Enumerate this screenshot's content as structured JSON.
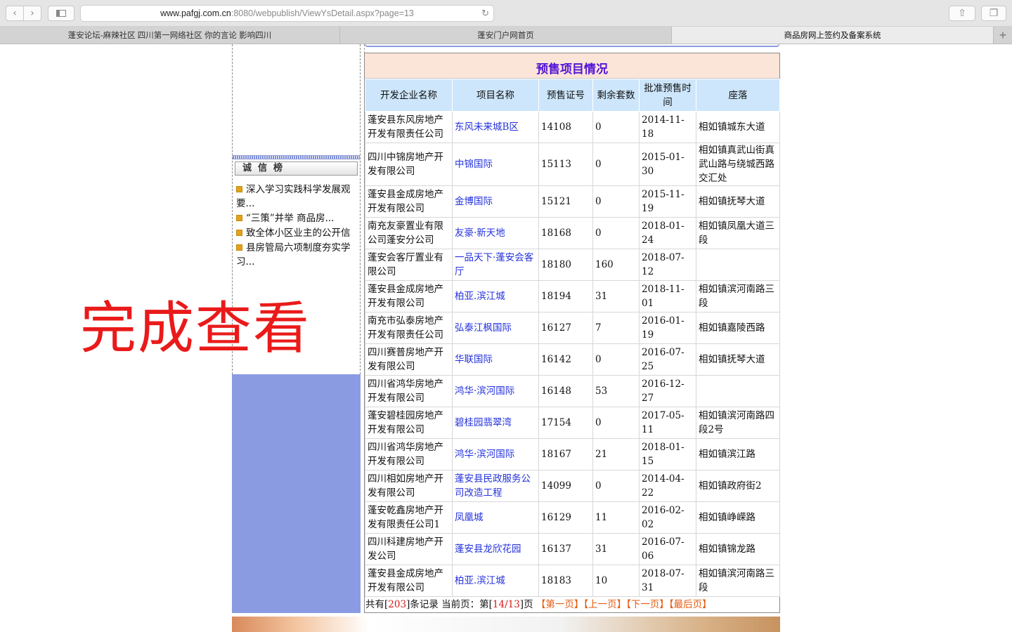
{
  "browser": {
    "url_host": "www.pafgj.com.cn",
    "url_rest": ":8080/webpublish/ViewYsDetail.aspx?page=13",
    "tabs": [
      {
        "label": "蓬安论坛-麻辣社区 四川第一网络社区 你的言论 影响四川"
      },
      {
        "label": "蓬安门户网首页"
      },
      {
        "label": "商品房网上签约及备案系统"
      }
    ]
  },
  "sidebar": {
    "section_title": "诚信榜",
    "items": [
      {
        "label": "深入学习实践科学发展观要..."
      },
      {
        "label": "“三策”并举 商品房..."
      },
      {
        "label": "致全体小区业主的公开信"
      },
      {
        "label": "县房管局六项制度夯实学习..."
      }
    ]
  },
  "overlay": {
    "text": "完成查看"
  },
  "main": {
    "title": "预售项目情况",
    "columns": [
      "开发企业名称",
      "项目名称",
      "预售证号",
      "剩余套数",
      "批准预售时间",
      "座落"
    ],
    "rows": [
      [
        "蓬安县东风房地产开发有限责任公司",
        "东风未来城B区",
        "14108",
        "0",
        "2014-11-18",
        "相如镇城东大道"
      ],
      [
        "四川中锦房地产开发有限公司",
        "中锦国际",
        "15113",
        "0",
        "2015-01-30",
        "相如镇真武山街真武山路与绕城西路交汇处"
      ],
      [
        "蓬安县金成房地产开发有限公司",
        "金博国际",
        "15121",
        "0",
        "2015-11-19",
        "相如镇抚琴大道"
      ],
      [
        "南充友豪置业有限公司蓬安分公司",
        "友豪·新天地",
        "18168",
        "0",
        "2018-01-24",
        "相如镇凤凰大道三段"
      ],
      [
        "蓬安会客厅置业有限公司",
        "一品天下·蓬安会客厅",
        "18180",
        "160",
        "2018-07-12",
        ""
      ],
      [
        "蓬安县金成房地产开发有限公司",
        "柏亚.滨江城",
        "18194",
        "31",
        "2018-11-01",
        "相如镇滨河南路三段"
      ],
      [
        "南充市弘泰房地产开发有限责任公司",
        "弘泰江枫国际",
        "16127",
        "7",
        "2016-01-19",
        "相如镇嘉陵西路"
      ],
      [
        "四川赛普房地产开发有限公司",
        "华联国际",
        "16142",
        "0",
        "2016-07-25",
        "相如镇抚琴大道"
      ],
      [
        "四川省鸿华房地产开发有限公司",
        "鸿华·滨河国际",
        "16148",
        "53",
        "2016-12-27",
        ""
      ],
      [
        "蓬安碧桂园房地产开发有限公司",
        "碧桂园翡翠湾",
        "17154",
        "0",
        "2017-05-11",
        "相如镇滨河南路四段2号"
      ],
      [
        "四川省鸿华房地产开发有限公司",
        "鸿华·滨河国际",
        "18167",
        "21",
        "2018-01-15",
        "相如镇滨江路"
      ],
      [
        "四川相如房地产开发有限公司",
        "蓬安县民政服务公司改造工程",
        "14099",
        "0",
        "2014-04-22",
        "相如镇政府街2"
      ],
      [
        "蓬安乾鑫房地产开发有限责任公司1",
        "凤凰城",
        "16129",
        "11",
        "2016-02-02",
        "相如镇峥嵘路"
      ],
      [
        "四川科建房地产开发公司",
        "蓬安县龙欣花园",
        "16137",
        "31",
        "2016-07-06",
        "相如镇锦龙路"
      ],
      [
        "蓬安县金成房地产开发有限公司",
        "柏亚.滨江城",
        "18183",
        "10",
        "2018-07-31",
        "相如镇滨河南路三段"
      ]
    ],
    "pager": {
      "prefix": "共有[",
      "total": "203",
      "mid": "]条记录  当前页：第[",
      "current": "14/13",
      "suffix": "]页",
      "first": "【第一页】",
      "prev": "【上一页】",
      "next": "【下一页】",
      "last": "【最后页】"
    }
  }
}
